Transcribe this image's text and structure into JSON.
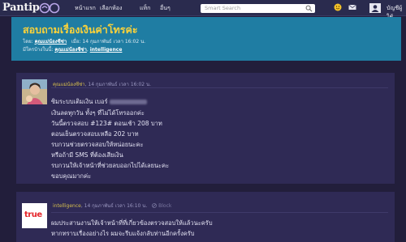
{
  "navbar": {
    "logo": "Pantip",
    "items": [
      "หน้าแรก",
      "เลือกห้อง",
      "แท็ก",
      "อื่นๆ"
    ],
    "search_placeholder": "Smart Search",
    "user_name": "บัญชีผู้ใช้"
  },
  "topic": {
    "title": "สอบถามเรื่องเงินค่าโทรค่ะ",
    "meta_by_label": "โดย:",
    "meta_by": "คุณแม่น้องซีซ่า",
    "meta_time": "เมื่อ: 14 กุมภาพันธ์ เวลา 16:02 น.",
    "meta_replied_label": "มีใครบ้างในนี้:",
    "meta_replied": [
      "คุณแม่น้องซีซ่า",
      "intelligence"
    ]
  },
  "post1": {
    "author": "คุณแม่น้องซีซ่า",
    "time": ", 14 กุมภาพันธ์ เวลา 16:02 น.",
    "lines": [
      "ซิมระบบเติมเงิน เบอร์",
      "เงินลดทุกวัน ทั้งๆ ที่ไม่ได้โทรออกค่ะ",
      "วันนี้ตรวจสอบ #123# ตอนเช้า 208 บาท",
      "ตอนเย็นตรวจสอบเหลือ 202 บาท",
      "รบกวนช่วยตรวจสอบให้หน่อยนะคะ",
      "หรือถ้ามี SMS ที่ต้องเสียเงิน",
      "รบกวนให้เจ้าหน้าที่ช่วยลบออกไปได้เลยนะคะ",
      "ขอบคุณมากค่ะ"
    ]
  },
  "post2": {
    "author": "intelligence",
    "time": ", 14 กุมภาพันธ์ เวลา 16:10 น.",
    "block": "Block",
    "logo_text": "true",
    "lines": [
      "ผมประสานงานให้เจ้าหน้าที่ที่เกี่ยวข้องตรวจสอบให้แล้วนะครับ",
      "หากทราบเรื่องอย่างไร ผมจะรีบแจ้งกลับท่านอีกครั้งครับ"
    ]
  },
  "colors": {
    "background": "#221e3b",
    "navbar": "#2a2b4e",
    "title_band": "#1f7da3",
    "title_text": "#fbd23a",
    "card": "#2f2a55",
    "author": "#d6bf4d"
  }
}
